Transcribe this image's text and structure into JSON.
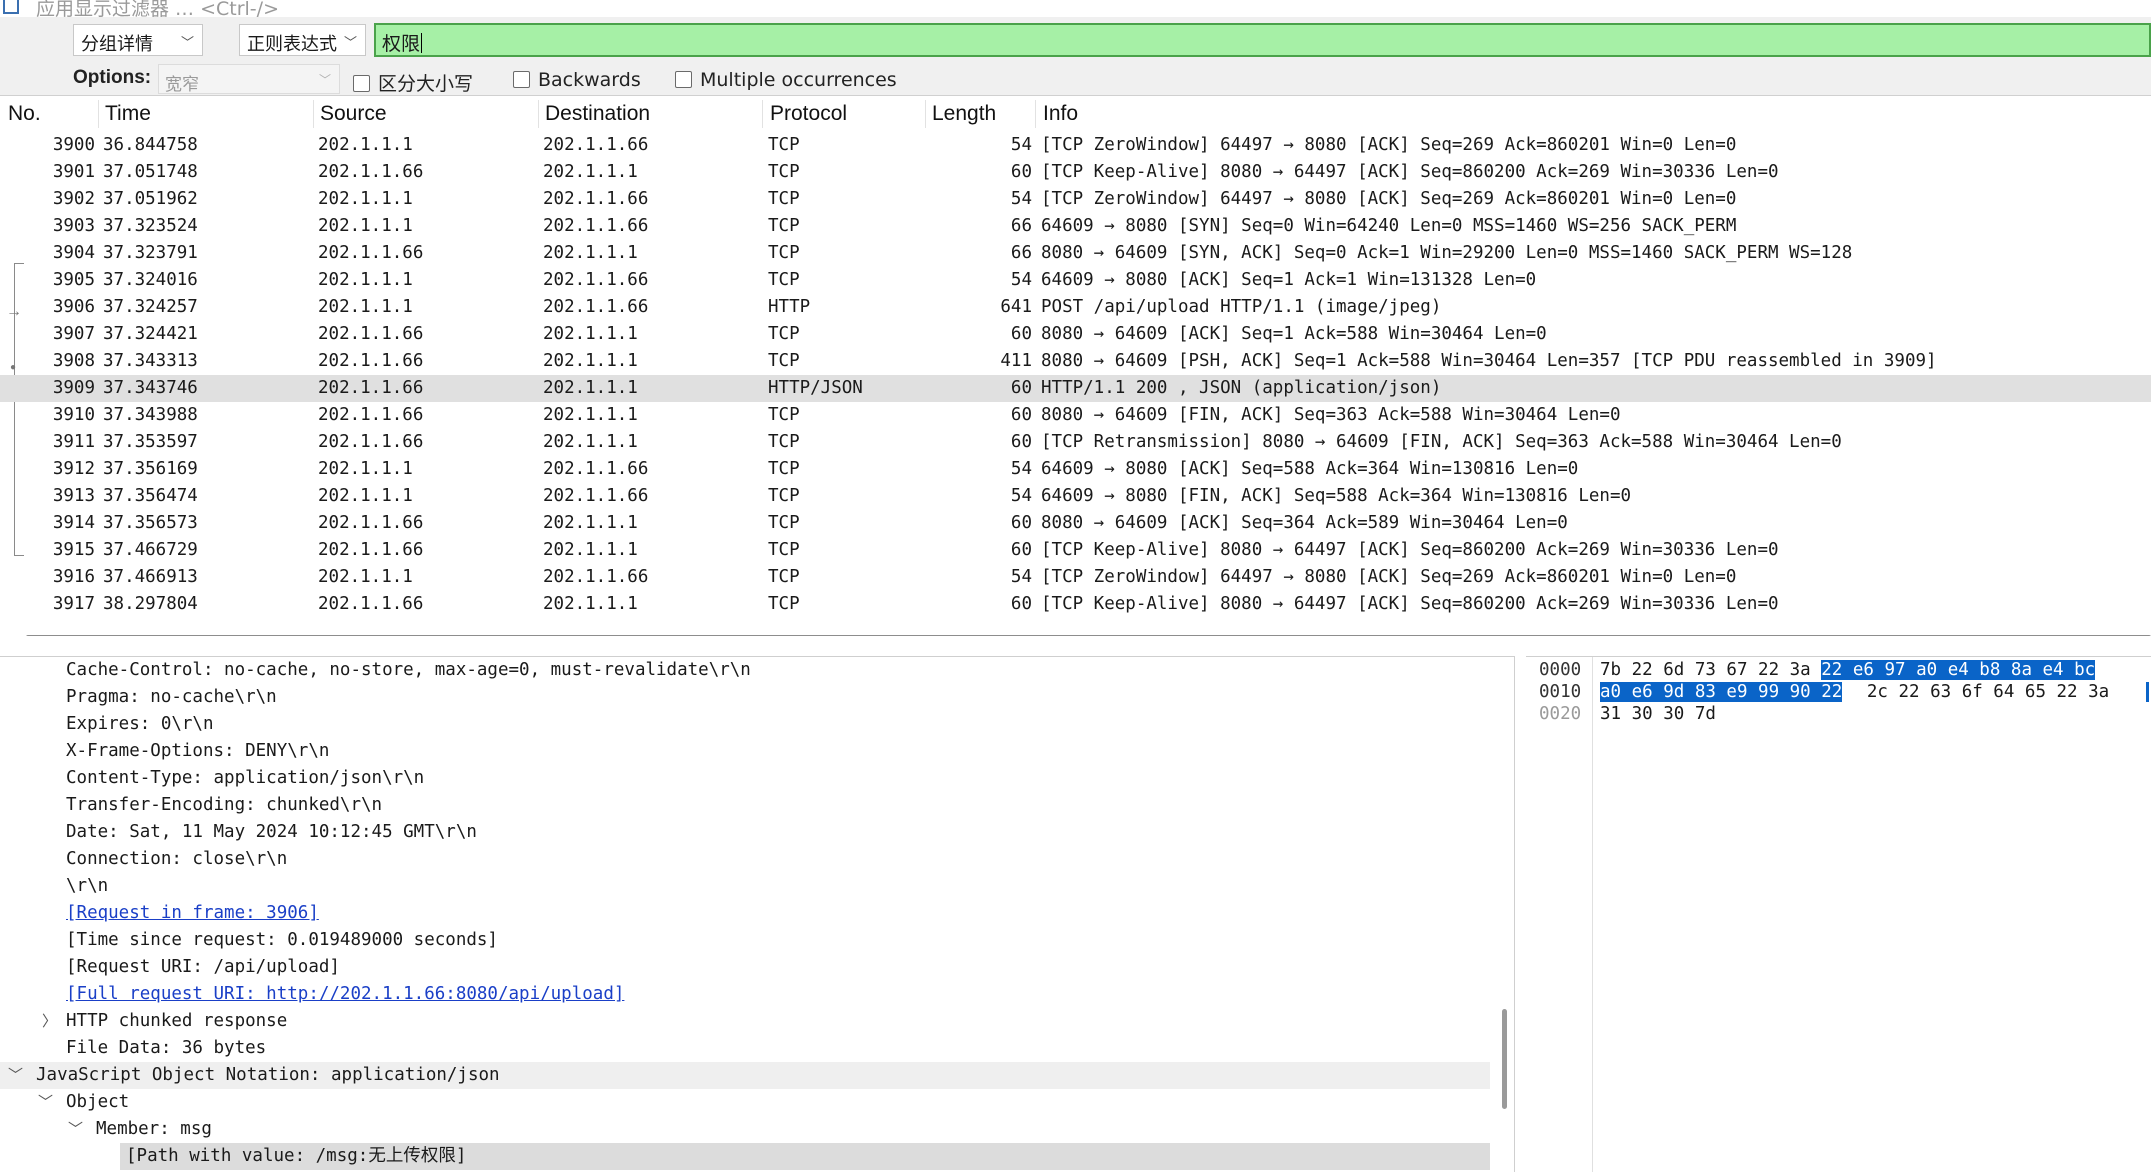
{
  "display_filter": {
    "placeholder": "应用显示过滤器 … <Ctrl-/>"
  },
  "find_bar": {
    "search_in": "分组详情",
    "search_type": "正则表达式",
    "search_value": "权限",
    "options_label": "Options:",
    "char_width": "宽窄",
    "case_sensitive": "区分大小写",
    "backwards": "Backwards",
    "multiple": "Multiple occurrences"
  },
  "packet_list": {
    "columns": [
      "No.",
      "Time",
      "Source",
      "Destination",
      "Protocol",
      "Length",
      "Info"
    ],
    "rows": [
      {
        "no": "3900",
        "time": "36.844758",
        "src": "202.1.1.1",
        "dst": "202.1.1.66",
        "proto": "TCP",
        "len": "54",
        "info": "[TCP ZeroWindow] 64497 → 8080 [ACK] Seq=269 Ack=860201 Win=0 Len=0"
      },
      {
        "no": "3901",
        "time": "37.051748",
        "src": "202.1.1.66",
        "dst": "202.1.1.1",
        "proto": "TCP",
        "len": "60",
        "info": "[TCP Keep-Alive] 8080 → 64497 [ACK] Seq=860200 Ack=269 Win=30336 Len=0"
      },
      {
        "no": "3902",
        "time": "37.051962",
        "src": "202.1.1.1",
        "dst": "202.1.1.66",
        "proto": "TCP",
        "len": "54",
        "info": "[TCP ZeroWindow] 64497 → 8080 [ACK] Seq=269 Ack=860201 Win=0 Len=0"
      },
      {
        "no": "3903",
        "time": "37.323524",
        "src": "202.1.1.1",
        "dst": "202.1.1.66",
        "proto": "TCP",
        "len": "66",
        "info": "64609 → 8080 [SYN] Seq=0 Win=64240 Len=0 MSS=1460 WS=256 SACK_PERM"
      },
      {
        "no": "3904",
        "time": "37.323791",
        "src": "202.1.1.66",
        "dst": "202.1.1.1",
        "proto": "TCP",
        "len": "66",
        "info": "8080 → 64609 [SYN, ACK] Seq=0 Ack=1 Win=29200 Len=0 MSS=1460 SACK_PERM WS=128"
      },
      {
        "no": "3905",
        "time": "37.324016",
        "src": "202.1.1.1",
        "dst": "202.1.1.66",
        "proto": "TCP",
        "len": "54",
        "info": "64609 → 8080 [ACK] Seq=1 Ack=1 Win=131328 Len=0"
      },
      {
        "no": "3906",
        "time": "37.324257",
        "src": "202.1.1.1",
        "dst": "202.1.1.66",
        "proto": "HTTP",
        "len": "641",
        "info": "POST /api/upload HTTP/1.1  (image/jpeg)"
      },
      {
        "no": "3907",
        "time": "37.324421",
        "src": "202.1.1.66",
        "dst": "202.1.1.1",
        "proto": "TCP",
        "len": "60",
        "info": "8080 → 64609 [ACK] Seq=1 Ack=588 Win=30464 Len=0"
      },
      {
        "no": "3908",
        "time": "37.343313",
        "src": "202.1.1.66",
        "dst": "202.1.1.1",
        "proto": "TCP",
        "len": "411",
        "info": "8080 → 64609 [PSH, ACK] Seq=1 Ack=588 Win=30464 Len=357 [TCP PDU reassembled in 3909]"
      },
      {
        "no": "3909",
        "time": "37.343746",
        "src": "202.1.1.66",
        "dst": "202.1.1.1",
        "proto": "HTTP/JSON",
        "len": "60",
        "info": "HTTP/1.1 200  , JSON (application/json)"
      },
      {
        "no": "3910",
        "time": "37.343988",
        "src": "202.1.1.66",
        "dst": "202.1.1.1",
        "proto": "TCP",
        "len": "60",
        "info": "8080 → 64609 [FIN, ACK] Seq=363 Ack=588 Win=30464 Len=0"
      },
      {
        "no": "3911",
        "time": "37.353597",
        "src": "202.1.1.66",
        "dst": "202.1.1.1",
        "proto": "TCP",
        "len": "60",
        "info": "[TCP Retransmission] 8080 → 64609 [FIN, ACK] Seq=363 Ack=588 Win=30464 Len=0"
      },
      {
        "no": "3912",
        "time": "37.356169",
        "src": "202.1.1.1",
        "dst": "202.1.1.66",
        "proto": "TCP",
        "len": "54",
        "info": "64609 → 8080 [ACK] Seq=588 Ack=364 Win=130816 Len=0"
      },
      {
        "no": "3913",
        "time": "37.356474",
        "src": "202.1.1.1",
        "dst": "202.1.1.66",
        "proto": "TCP",
        "len": "54",
        "info": "64609 → 8080 [FIN, ACK] Seq=588 Ack=364 Win=130816 Len=0"
      },
      {
        "no": "3914",
        "time": "37.356573",
        "src": "202.1.1.66",
        "dst": "202.1.1.1",
        "proto": "TCP",
        "len": "60",
        "info": "8080 → 64609 [ACK] Seq=364 Ack=589 Win=30464 Len=0"
      },
      {
        "no": "3915",
        "time": "37.466729",
        "src": "202.1.1.66",
        "dst": "202.1.1.1",
        "proto": "TCP",
        "len": "60",
        "info": "[TCP Keep-Alive] 8080 → 64497 [ACK] Seq=860200 Ack=269 Win=30336 Len=0"
      },
      {
        "no": "3916",
        "time": "37.466913",
        "src": "202.1.1.1",
        "dst": "202.1.1.66",
        "proto": "TCP",
        "len": "54",
        "info": "[TCP ZeroWindow] 64497 → 8080 [ACK] Seq=269 Ack=860201 Win=0 Len=0"
      },
      {
        "no": "3917",
        "time": "38.297804",
        "src": "202.1.1.66",
        "dst": "202.1.1.1",
        "proto": "TCP",
        "len": "60",
        "info": "[TCP Keep-Alive] 8080 → 64497 [ACK] Seq=860200 Ack=269 Win=30336 Len=0"
      }
    ]
  },
  "details": {
    "lines": [
      "Cache-Control: no-cache, no-store, max-age=0, must-revalidate\\r\\n",
      "Pragma: no-cache\\r\\n",
      "Expires: 0\\r\\n",
      "X-Frame-Options: DENY\\r\\n",
      "Content-Type: application/json\\r\\n",
      "Transfer-Encoding: chunked\\r\\n",
      "Date: Sat, 11 May 2024 10:12:45 GMT\\r\\n",
      "Connection: close\\r\\n",
      "\\r\\n",
      "[Request in frame: 3906]",
      "[Time since request: 0.019489000 seconds]",
      "[Request URI: /api/upload]",
      "[Full request URI: http://202.1.1.66:8080/api/upload]",
      "HTTP chunked response",
      "File Data: 36 bytes",
      "JavaScript Object Notation: application/json",
      "Object",
      "Member: msg",
      "[Path with value: /msg:无上传权限]"
    ]
  },
  "bytes": {
    "offsets": [
      "0000",
      "0010",
      "0020"
    ],
    "row0_plain": "7b 22 6d 73 67 22 3a",
    "row0_sel": "22  e6 97 a0 e4 b8 8a e4 bc",
    "row1_sel": "a0 e6 9d 83 e9 99 90 22",
    "row1_plain": "2c 22 63 6f 64 65 22 3a",
    "row2_plain": "31 30 30 7d"
  },
  "colors": {
    "search_bg": "#a6f0a6",
    "selection_blue": "#0a64c8",
    "link_blue": "#1a3fc7",
    "selected_row": "#e0e0e0"
  }
}
